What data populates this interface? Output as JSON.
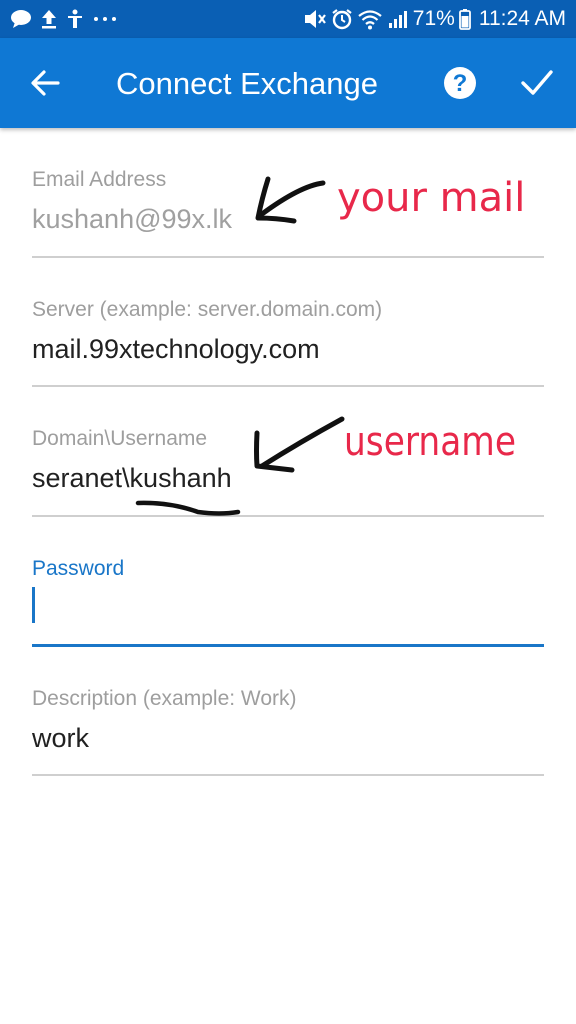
{
  "status_bar": {
    "battery_percent": "71%",
    "time": "11:24 AM",
    "left_icons": [
      "chat-bubble-icon",
      "upload-icon",
      "accessibility-icon",
      "more-dots-icon"
    ],
    "right_icons": [
      "mute-icon",
      "alarm-icon",
      "wifi-icon",
      "signal-icon",
      "battery-icon"
    ]
  },
  "app_bar": {
    "title": "Connect Exchange",
    "background": "#0f78d4",
    "status_background": "#0a5fb4"
  },
  "form": {
    "email": {
      "label": "Email Address",
      "value": "kushanh@99x.lk"
    },
    "server": {
      "label": "Server (example: server.domain.com)",
      "value": "mail.99xtechnology.com"
    },
    "domain_username": {
      "label": "Domain\\Username",
      "value": "seranet\\kushanh"
    },
    "password": {
      "label": "Password",
      "value": ""
    },
    "description": {
      "label": "Description (example: Work)",
      "value": "work"
    }
  },
  "annotations": {
    "mail_note": "your mail",
    "username_note": "username",
    "color": "#e8284a"
  }
}
